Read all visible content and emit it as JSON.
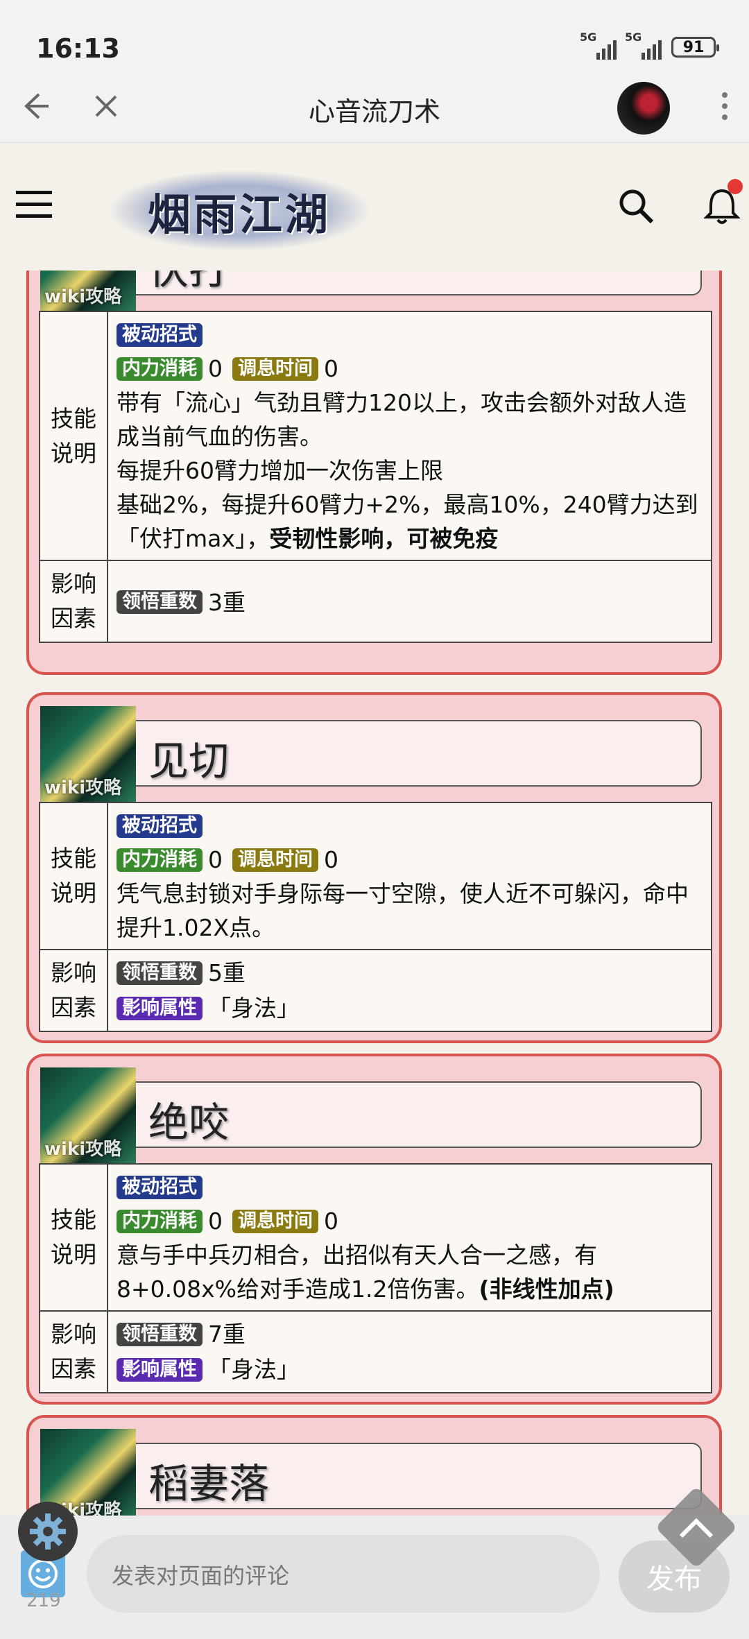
{
  "status": {
    "time": "16:13",
    "net1": "5G",
    "net2": "5G",
    "battery": "91"
  },
  "titlebar": {
    "title": "心音流刀术"
  },
  "site": {
    "logo": "烟雨江湖",
    "watermark": "wiki攻略"
  },
  "skills": [
    {
      "name": "伏打",
      "tags": {
        "passive": "被动招式",
        "neili": "内力消耗",
        "tiaoxi": "调息时间",
        "lingwu": "领悟重数"
      },
      "neili_val": "0",
      "tiaoxi_val": "0",
      "desc": [
        "带有「流心」气劲且臂力120以上，攻击会额外对敌人造成当前气血的伤害。",
        "每提升60臂力增加一次伤害上限",
        "基础2%，每提升60臂力+2%，最高10%，240臂力达到「伏打max」，"
      ],
      "desc_bold": "受韧性影响，可被免疫",
      "lingwu_val": "3重"
    },
    {
      "name": "见切",
      "neili_val": "0",
      "tiaoxi_val": "0",
      "desc": "凭气息封锁对手身际每一寸空隙，使人近不可躲闪，命中提升1.02X点。",
      "lingwu_val": "5重",
      "attr_tag": "影响属性",
      "attr_val": "「身法」"
    },
    {
      "name": "绝咬",
      "neili_val": "0",
      "tiaoxi_val": "0",
      "desc": "意与手中兵刃相合，出招似有天人合一之感，有8+0.08x%给对手造成1.2倍伤害。",
      "desc_bold": "(非线性加点)",
      "lingwu_val": "7重",
      "attr_tag": "影响属性",
      "attr_val": "「身法」"
    },
    {
      "name": "稻妻落"
    }
  ],
  "row_labels": {
    "skill_l1": "技能",
    "skill_l2": "说明",
    "factor_l1": "影响",
    "factor_l2": "因素"
  },
  "bottom": {
    "comment_placeholder": "发表对页面的评论",
    "publish": "发布",
    "count": "219"
  }
}
